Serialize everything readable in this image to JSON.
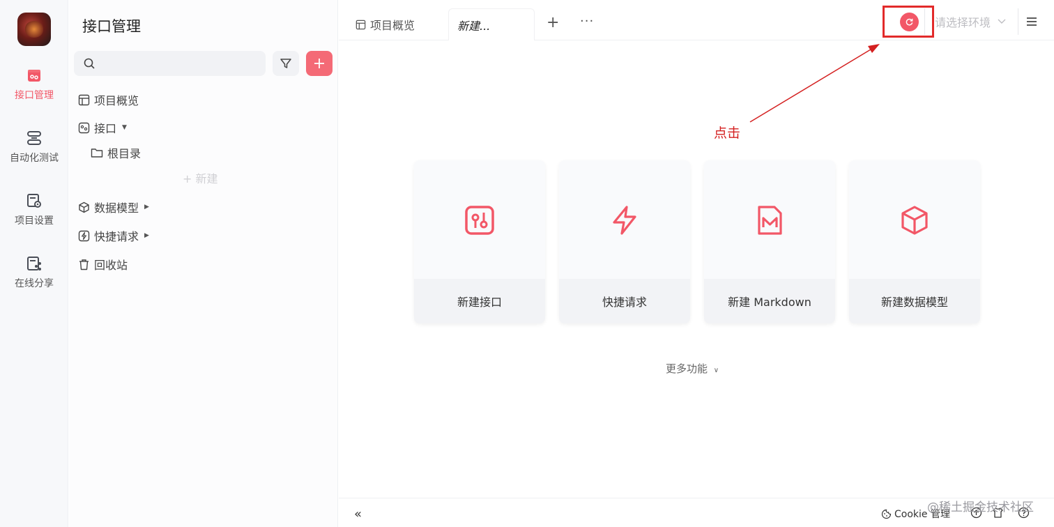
{
  "colors": {
    "accent": "#f25767",
    "annotation": "#e22a2a"
  },
  "rail": {
    "items": [
      {
        "label": "接口管理",
        "icon": "api-icon",
        "active": true
      },
      {
        "label": "自动化测试",
        "icon": "automation-icon"
      },
      {
        "label": "项目设置",
        "icon": "project-settings-icon"
      },
      {
        "label": "在线分享",
        "icon": "share-icon"
      }
    ]
  },
  "sidebar": {
    "title": "接口管理",
    "search_placeholder": "",
    "tree": [
      {
        "label": "项目概览",
        "icon": "overview-icon"
      },
      {
        "label": "接口",
        "icon": "api-icon"
      },
      {
        "label": "根目录",
        "icon": "folder-icon"
      },
      {
        "label": "数据模型",
        "icon": "cube-icon"
      },
      {
        "label": "快捷请求",
        "icon": "lightning-icon"
      },
      {
        "label": "回收站",
        "icon": "trash-icon"
      }
    ],
    "ghost_new": "+ 新建"
  },
  "tabs": [
    {
      "label": "项目概览",
      "icon": "overview-icon"
    },
    {
      "label": "新建...",
      "active": true
    }
  ],
  "env_select": {
    "placeholder": "请选择环境"
  },
  "annotation": {
    "label": "点击"
  },
  "cards": [
    {
      "label": "新建接口",
      "icon": "api-icon"
    },
    {
      "label": "快捷请求",
      "icon": "lightning-icon"
    },
    {
      "label": "新建 Markdown",
      "icon": "markdown-icon"
    },
    {
      "label": "新建数据模型",
      "icon": "cube-icon"
    }
  ],
  "more_functions": "更多功能",
  "footer": {
    "collapse": "«",
    "cookie_label": "Cookie 管理"
  },
  "watermark": "@稀土掘金技术社区"
}
